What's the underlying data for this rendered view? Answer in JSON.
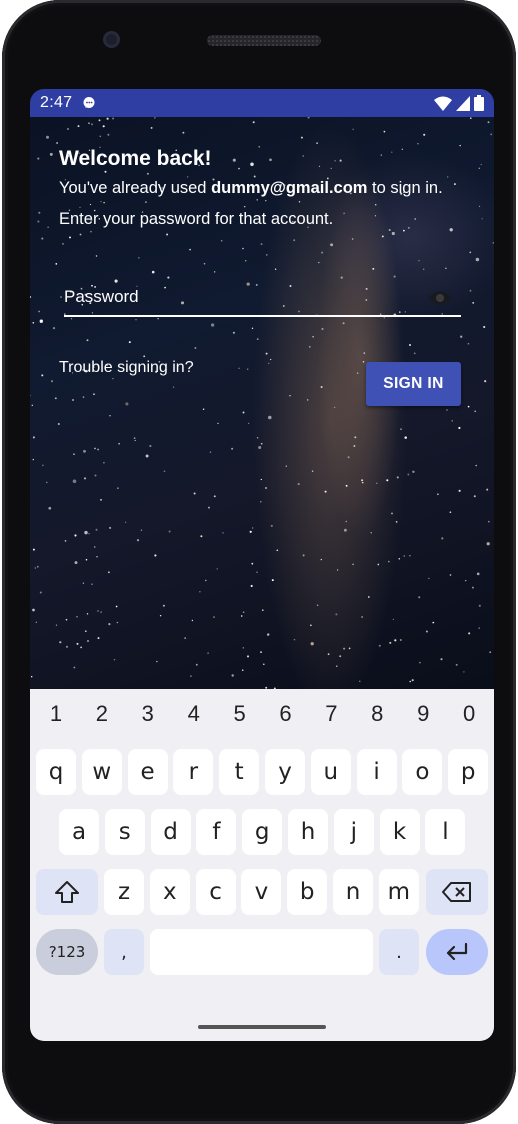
{
  "status_bar": {
    "time": "2:47",
    "icons": [
      "chat-notification-icon",
      "wifi-icon",
      "cell-signal-icon",
      "battery-icon"
    ],
    "color": "#2f3ea3"
  },
  "signin": {
    "title": "Welcome back!",
    "message_prefix": "You've already used ",
    "email": "dummy@gmail.com",
    "message_suffix": " to sign in. Enter your password for that account.",
    "password_placeholder": "Password",
    "trouble_link": "Trouble signing in?",
    "signin_button": "SIGN IN",
    "accent_color": "#3f51b5"
  },
  "keyboard": {
    "numbers": [
      "1",
      "2",
      "3",
      "4",
      "5",
      "6",
      "7",
      "8",
      "9",
      "0"
    ],
    "row1": [
      "q",
      "w",
      "e",
      "r",
      "t",
      "y",
      "u",
      "i",
      "o",
      "p"
    ],
    "row2": [
      "a",
      "s",
      "d",
      "f",
      "g",
      "h",
      "j",
      "k",
      "l"
    ],
    "row3": [
      "z",
      "x",
      "c",
      "v",
      "b",
      "n",
      "m"
    ],
    "symbols_key": "?123",
    "comma_key": ",",
    "period_key": ".",
    "shift_icon": "shift-icon",
    "backspace_icon": "backspace-icon",
    "enter_icon": "enter-icon"
  }
}
